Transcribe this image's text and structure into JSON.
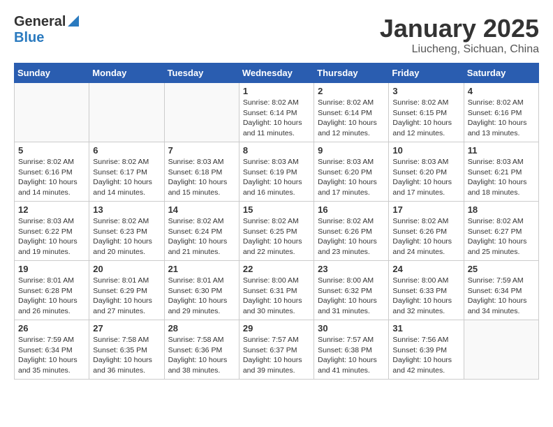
{
  "header": {
    "logo_general": "General",
    "logo_blue": "Blue",
    "title": "January 2025",
    "subtitle": "Liucheng, Sichuan, China"
  },
  "calendar": {
    "days_of_week": [
      "Sunday",
      "Monday",
      "Tuesday",
      "Wednesday",
      "Thursday",
      "Friday",
      "Saturday"
    ],
    "weeks": [
      [
        {
          "day": "",
          "detail": ""
        },
        {
          "day": "",
          "detail": ""
        },
        {
          "day": "",
          "detail": ""
        },
        {
          "day": "1",
          "detail": "Sunrise: 8:02 AM\nSunset: 6:14 PM\nDaylight: 10 hours\nand 11 minutes."
        },
        {
          "day": "2",
          "detail": "Sunrise: 8:02 AM\nSunset: 6:14 PM\nDaylight: 10 hours\nand 12 minutes."
        },
        {
          "day": "3",
          "detail": "Sunrise: 8:02 AM\nSunset: 6:15 PM\nDaylight: 10 hours\nand 12 minutes."
        },
        {
          "day": "4",
          "detail": "Sunrise: 8:02 AM\nSunset: 6:16 PM\nDaylight: 10 hours\nand 13 minutes."
        }
      ],
      [
        {
          "day": "5",
          "detail": "Sunrise: 8:02 AM\nSunset: 6:16 PM\nDaylight: 10 hours\nand 14 minutes."
        },
        {
          "day": "6",
          "detail": "Sunrise: 8:02 AM\nSunset: 6:17 PM\nDaylight: 10 hours\nand 14 minutes."
        },
        {
          "day": "7",
          "detail": "Sunrise: 8:03 AM\nSunset: 6:18 PM\nDaylight: 10 hours\nand 15 minutes."
        },
        {
          "day": "8",
          "detail": "Sunrise: 8:03 AM\nSunset: 6:19 PM\nDaylight: 10 hours\nand 16 minutes."
        },
        {
          "day": "9",
          "detail": "Sunrise: 8:03 AM\nSunset: 6:20 PM\nDaylight: 10 hours\nand 17 minutes."
        },
        {
          "day": "10",
          "detail": "Sunrise: 8:03 AM\nSunset: 6:20 PM\nDaylight: 10 hours\nand 17 minutes."
        },
        {
          "day": "11",
          "detail": "Sunrise: 8:03 AM\nSunset: 6:21 PM\nDaylight: 10 hours\nand 18 minutes."
        }
      ],
      [
        {
          "day": "12",
          "detail": "Sunrise: 8:03 AM\nSunset: 6:22 PM\nDaylight: 10 hours\nand 19 minutes."
        },
        {
          "day": "13",
          "detail": "Sunrise: 8:02 AM\nSunset: 6:23 PM\nDaylight: 10 hours\nand 20 minutes."
        },
        {
          "day": "14",
          "detail": "Sunrise: 8:02 AM\nSunset: 6:24 PM\nDaylight: 10 hours\nand 21 minutes."
        },
        {
          "day": "15",
          "detail": "Sunrise: 8:02 AM\nSunset: 6:25 PM\nDaylight: 10 hours\nand 22 minutes."
        },
        {
          "day": "16",
          "detail": "Sunrise: 8:02 AM\nSunset: 6:26 PM\nDaylight: 10 hours\nand 23 minutes."
        },
        {
          "day": "17",
          "detail": "Sunrise: 8:02 AM\nSunset: 6:26 PM\nDaylight: 10 hours\nand 24 minutes."
        },
        {
          "day": "18",
          "detail": "Sunrise: 8:02 AM\nSunset: 6:27 PM\nDaylight: 10 hours\nand 25 minutes."
        }
      ],
      [
        {
          "day": "19",
          "detail": "Sunrise: 8:01 AM\nSunset: 6:28 PM\nDaylight: 10 hours\nand 26 minutes."
        },
        {
          "day": "20",
          "detail": "Sunrise: 8:01 AM\nSunset: 6:29 PM\nDaylight: 10 hours\nand 27 minutes."
        },
        {
          "day": "21",
          "detail": "Sunrise: 8:01 AM\nSunset: 6:30 PM\nDaylight: 10 hours\nand 29 minutes."
        },
        {
          "day": "22",
          "detail": "Sunrise: 8:00 AM\nSunset: 6:31 PM\nDaylight: 10 hours\nand 30 minutes."
        },
        {
          "day": "23",
          "detail": "Sunrise: 8:00 AM\nSunset: 6:32 PM\nDaylight: 10 hours\nand 31 minutes."
        },
        {
          "day": "24",
          "detail": "Sunrise: 8:00 AM\nSunset: 6:33 PM\nDaylight: 10 hours\nand 32 minutes."
        },
        {
          "day": "25",
          "detail": "Sunrise: 7:59 AM\nSunset: 6:34 PM\nDaylight: 10 hours\nand 34 minutes."
        }
      ],
      [
        {
          "day": "26",
          "detail": "Sunrise: 7:59 AM\nSunset: 6:34 PM\nDaylight: 10 hours\nand 35 minutes."
        },
        {
          "day": "27",
          "detail": "Sunrise: 7:58 AM\nSunset: 6:35 PM\nDaylight: 10 hours\nand 36 minutes."
        },
        {
          "day": "28",
          "detail": "Sunrise: 7:58 AM\nSunset: 6:36 PM\nDaylight: 10 hours\nand 38 minutes."
        },
        {
          "day": "29",
          "detail": "Sunrise: 7:57 AM\nSunset: 6:37 PM\nDaylight: 10 hours\nand 39 minutes."
        },
        {
          "day": "30",
          "detail": "Sunrise: 7:57 AM\nSunset: 6:38 PM\nDaylight: 10 hours\nand 41 minutes."
        },
        {
          "day": "31",
          "detail": "Sunrise: 7:56 AM\nSunset: 6:39 PM\nDaylight: 10 hours\nand 42 minutes."
        },
        {
          "day": "",
          "detail": ""
        }
      ]
    ]
  }
}
